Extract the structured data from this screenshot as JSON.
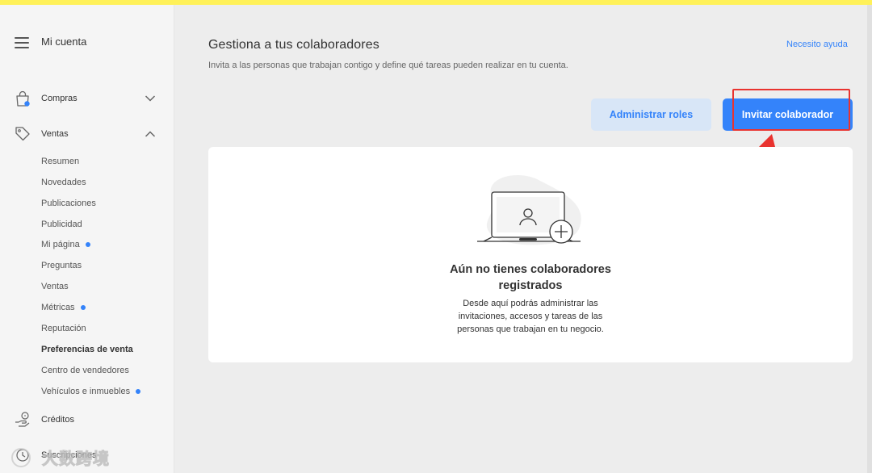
{
  "sidebar": {
    "title": "Mi cuenta",
    "sections": {
      "compras": "Compras",
      "ventas": "Ventas",
      "creditos": "Créditos",
      "suscripciones": "Suscripciones"
    },
    "ventas_items": [
      {
        "label": "Resumen",
        "dot": false,
        "active": false
      },
      {
        "label": "Novedades",
        "dot": false,
        "active": false
      },
      {
        "label": "Publicaciones",
        "dot": false,
        "active": false
      },
      {
        "label": "Publicidad",
        "dot": false,
        "active": false
      },
      {
        "label": "Mi página",
        "dot": true,
        "active": false
      },
      {
        "label": "Preguntas",
        "dot": false,
        "active": false
      },
      {
        "label": "Ventas",
        "dot": false,
        "active": false
      },
      {
        "label": "Métricas",
        "dot": true,
        "active": false
      },
      {
        "label": "Reputación",
        "dot": false,
        "active": false
      },
      {
        "label": "Preferencias de venta",
        "dot": false,
        "active": true
      },
      {
        "label": "Centro de vendedores",
        "dot": false,
        "active": false
      },
      {
        "label": "Vehículos e inmuebles",
        "dot": true,
        "active": false
      }
    ]
  },
  "header": {
    "title": "Gestiona a tus colaboradores",
    "subtitle": "Invita a las personas que trabajan contigo y define qué tareas pueden realizar en tu cuenta.",
    "help_link": "Necesito ayuda"
  },
  "actions": {
    "manage_roles": "Administrar roles",
    "invite": "Invitar colaborador"
  },
  "empty_state": {
    "title_line1": "Aún no tienes colaboradores",
    "title_line2": "registrados",
    "desc_line1": "Desde aquí podrás administrar las",
    "desc_line2": "invitaciones, accesos y tareas de las",
    "desc_line3": "personas que trabajan en tu negocio."
  },
  "watermark": {
    "text": "大数跨境"
  },
  "colors": {
    "brand_yellow": "#fff159",
    "accent_blue": "#3483fa",
    "annotation_red": "#e9332f",
    "notification_dot": "#3483fa"
  },
  "icons": {
    "menu": "hamburger-icon",
    "compras": "shopping-bag-icon",
    "ventas": "price-tag-icon",
    "creditos": "hand-coin-icon",
    "suscripciones": "subscription-icon",
    "expand": "chevron-down-icon",
    "collapse": "chevron-up-icon"
  }
}
